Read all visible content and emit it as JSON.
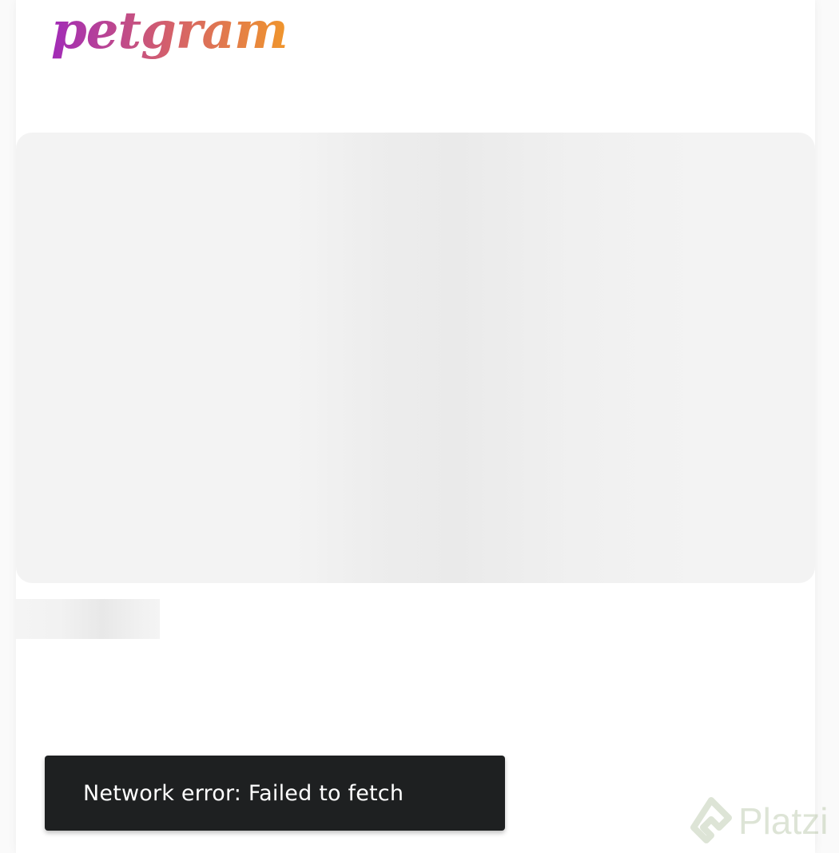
{
  "header": {
    "logo_text": "petgram"
  },
  "colors": {
    "logo_gradient_start": "#a12bb8",
    "logo_gradient_mid": "#d4606b",
    "logo_gradient_end": "#f0962c",
    "snackbar_bg": "#1e2021",
    "skeleton": "#f3f3f3"
  },
  "snackbar": {
    "message": "Network error: Failed to fetch"
  },
  "watermark": {
    "text": "Platzi"
  }
}
